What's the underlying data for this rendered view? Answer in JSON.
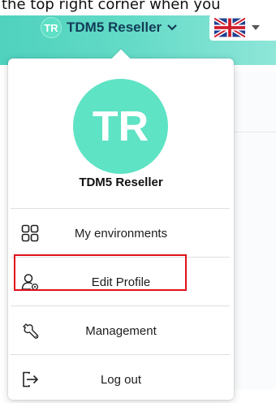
{
  "caption": "the top right corner when you",
  "header": {
    "user_initials": "TR",
    "user_name": "TDM5 Reseller"
  },
  "menu": {
    "avatar_initials": "TR",
    "user_name": "TDM5 Reseller",
    "items": [
      {
        "label": "My environments",
        "icon": "grid-icon"
      },
      {
        "label": "Edit Profile",
        "icon": "user-settings-icon"
      },
      {
        "label": "Management",
        "icon": "wrench-icon"
      },
      {
        "label": "Log out",
        "icon": "logout-icon"
      }
    ]
  },
  "colors": {
    "accent": "#5ee3c4",
    "highlight": "#e0101a"
  }
}
